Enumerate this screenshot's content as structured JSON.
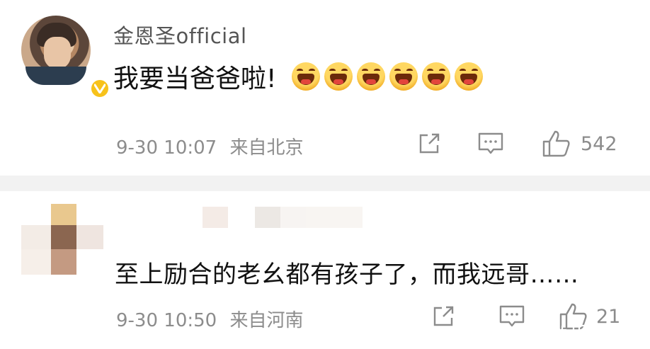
{
  "post": {
    "username": "金恩圣official",
    "content": "我要当爸爸啦!",
    "emoji_icons": [
      "laughing-emoji-icon",
      "laughing-emoji-icon",
      "laughing-emoji-icon",
      "laughing-emoji-icon",
      "laughing-emoji-icon",
      "laughing-emoji-icon"
    ],
    "timestamp": "9-30 10:07",
    "source": "来自北京",
    "like_count": "542"
  },
  "comment": {
    "content": "至上励合的老幺都有孩子了，而我远哥……",
    "timestamp": "9-30 10:50",
    "source": "来自河南",
    "like_count": "21"
  },
  "colors": {
    "meta_text": "#8c8c8c",
    "verified_badge": "#f7c21b",
    "divider": "#f2f2f2"
  }
}
